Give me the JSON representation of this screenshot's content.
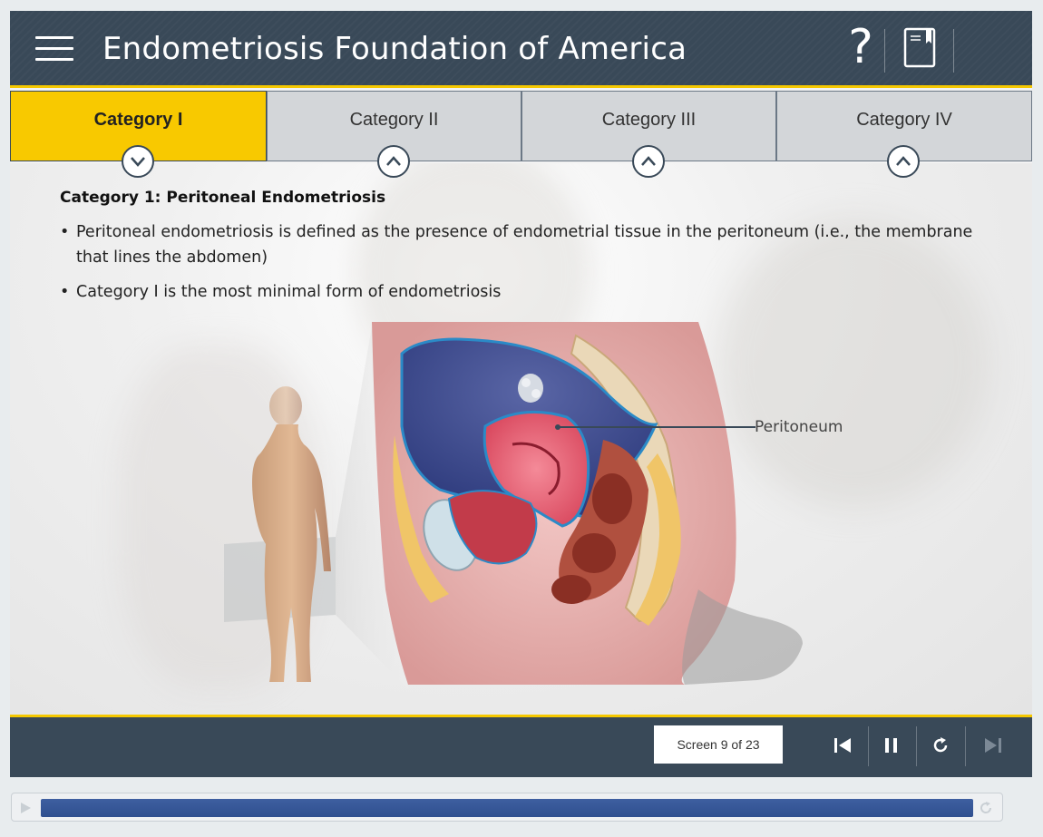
{
  "header": {
    "title": "Endometriosis Foundation of America",
    "help_label": "?",
    "menu_icon": "hamburger-menu-icon",
    "notes_icon": "notebook-icon"
  },
  "tabs": [
    {
      "label": "Category I",
      "active": true,
      "chevron": "chevron-down"
    },
    {
      "label": "Category II",
      "active": false,
      "chevron": "chevron-up"
    },
    {
      "label": "Category III",
      "active": false,
      "chevron": "chevron-up"
    },
    {
      "label": "Category IV",
      "active": false,
      "chevron": "chevron-up"
    }
  ],
  "content": {
    "title": "Category 1: Peritoneal Endometriosis",
    "bullets": [
      "Peritoneal endometriosis is defined as the presence of endometrial tissue in the peritoneum (i.e., the membrane that lines the abdomen)",
      "Category I is the most minimal form of endometriosis"
    ],
    "bullet_marker": "•",
    "illustration_label": "Peritoneum"
  },
  "footer": {
    "screen_counter": "Screen 9 of 23",
    "buttons": [
      "previous-icon",
      "pause-icon",
      "replay-icon",
      "next-icon"
    ]
  },
  "progress": {
    "fraction": 1.0
  },
  "colors": {
    "header_bg": "#394958",
    "accent": "#f8c900",
    "tab_inactive": "#d3d6d9",
    "progress_fill": "#3e5fa0"
  }
}
